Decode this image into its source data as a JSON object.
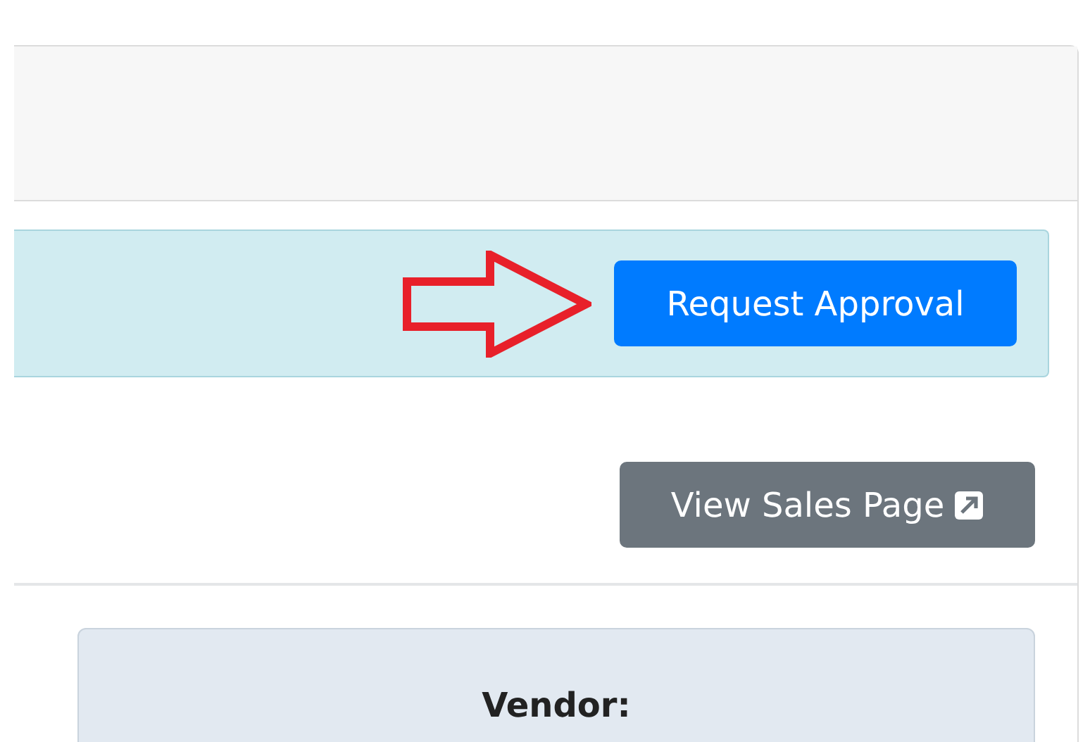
{
  "approval_alert": {
    "button": "Request Approval"
  },
  "sales_page_button": {
    "label": "View Sales Page"
  },
  "vendor_panel": {
    "label": "Vendor:"
  }
}
